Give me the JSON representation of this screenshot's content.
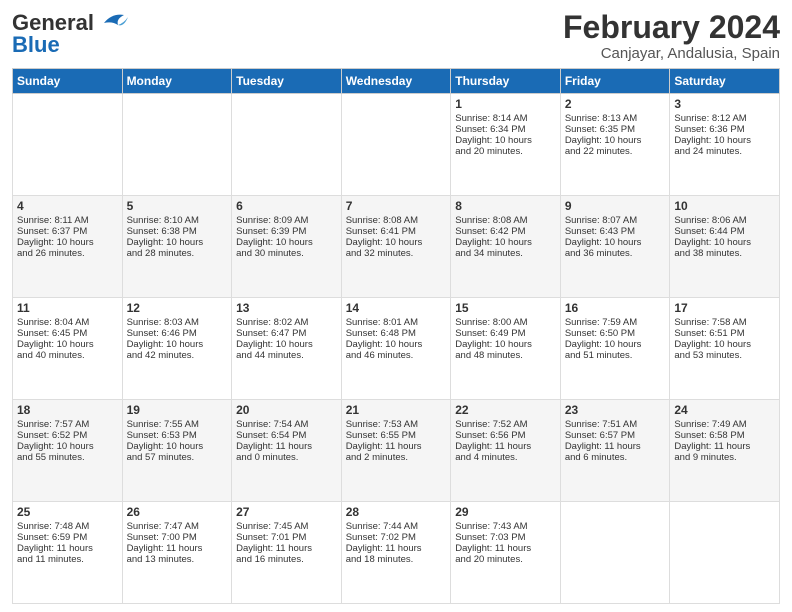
{
  "header": {
    "logo_general": "General",
    "logo_blue": "Blue",
    "month_year": "February 2024",
    "location": "Canjayar, Andalusia, Spain"
  },
  "days_of_week": [
    "Sunday",
    "Monday",
    "Tuesday",
    "Wednesday",
    "Thursday",
    "Friday",
    "Saturday"
  ],
  "weeks": [
    [
      {
        "day": "",
        "info": ""
      },
      {
        "day": "",
        "info": ""
      },
      {
        "day": "",
        "info": ""
      },
      {
        "day": "",
        "info": ""
      },
      {
        "day": "1",
        "info": "Sunrise: 8:14 AM\nSunset: 6:34 PM\nDaylight: 10 hours\nand 20 minutes."
      },
      {
        "day": "2",
        "info": "Sunrise: 8:13 AM\nSunset: 6:35 PM\nDaylight: 10 hours\nand 22 minutes."
      },
      {
        "day": "3",
        "info": "Sunrise: 8:12 AM\nSunset: 6:36 PM\nDaylight: 10 hours\nand 24 minutes."
      }
    ],
    [
      {
        "day": "4",
        "info": "Sunrise: 8:11 AM\nSunset: 6:37 PM\nDaylight: 10 hours\nand 26 minutes."
      },
      {
        "day": "5",
        "info": "Sunrise: 8:10 AM\nSunset: 6:38 PM\nDaylight: 10 hours\nand 28 minutes."
      },
      {
        "day": "6",
        "info": "Sunrise: 8:09 AM\nSunset: 6:39 PM\nDaylight: 10 hours\nand 30 minutes."
      },
      {
        "day": "7",
        "info": "Sunrise: 8:08 AM\nSunset: 6:41 PM\nDaylight: 10 hours\nand 32 minutes."
      },
      {
        "day": "8",
        "info": "Sunrise: 8:08 AM\nSunset: 6:42 PM\nDaylight: 10 hours\nand 34 minutes."
      },
      {
        "day": "9",
        "info": "Sunrise: 8:07 AM\nSunset: 6:43 PM\nDaylight: 10 hours\nand 36 minutes."
      },
      {
        "day": "10",
        "info": "Sunrise: 8:06 AM\nSunset: 6:44 PM\nDaylight: 10 hours\nand 38 minutes."
      }
    ],
    [
      {
        "day": "11",
        "info": "Sunrise: 8:04 AM\nSunset: 6:45 PM\nDaylight: 10 hours\nand 40 minutes."
      },
      {
        "day": "12",
        "info": "Sunrise: 8:03 AM\nSunset: 6:46 PM\nDaylight: 10 hours\nand 42 minutes."
      },
      {
        "day": "13",
        "info": "Sunrise: 8:02 AM\nSunset: 6:47 PM\nDaylight: 10 hours\nand 44 minutes."
      },
      {
        "day": "14",
        "info": "Sunrise: 8:01 AM\nSunset: 6:48 PM\nDaylight: 10 hours\nand 46 minutes."
      },
      {
        "day": "15",
        "info": "Sunrise: 8:00 AM\nSunset: 6:49 PM\nDaylight: 10 hours\nand 48 minutes."
      },
      {
        "day": "16",
        "info": "Sunrise: 7:59 AM\nSunset: 6:50 PM\nDaylight: 10 hours\nand 51 minutes."
      },
      {
        "day": "17",
        "info": "Sunrise: 7:58 AM\nSunset: 6:51 PM\nDaylight: 10 hours\nand 53 minutes."
      }
    ],
    [
      {
        "day": "18",
        "info": "Sunrise: 7:57 AM\nSunset: 6:52 PM\nDaylight: 10 hours\nand 55 minutes."
      },
      {
        "day": "19",
        "info": "Sunrise: 7:55 AM\nSunset: 6:53 PM\nDaylight: 10 hours\nand 57 minutes."
      },
      {
        "day": "20",
        "info": "Sunrise: 7:54 AM\nSunset: 6:54 PM\nDaylight: 11 hours\nand 0 minutes."
      },
      {
        "day": "21",
        "info": "Sunrise: 7:53 AM\nSunset: 6:55 PM\nDaylight: 11 hours\nand 2 minutes."
      },
      {
        "day": "22",
        "info": "Sunrise: 7:52 AM\nSunset: 6:56 PM\nDaylight: 11 hours\nand 4 minutes."
      },
      {
        "day": "23",
        "info": "Sunrise: 7:51 AM\nSunset: 6:57 PM\nDaylight: 11 hours\nand 6 minutes."
      },
      {
        "day": "24",
        "info": "Sunrise: 7:49 AM\nSunset: 6:58 PM\nDaylight: 11 hours\nand 9 minutes."
      }
    ],
    [
      {
        "day": "25",
        "info": "Sunrise: 7:48 AM\nSunset: 6:59 PM\nDaylight: 11 hours\nand 11 minutes."
      },
      {
        "day": "26",
        "info": "Sunrise: 7:47 AM\nSunset: 7:00 PM\nDaylight: 11 hours\nand 13 minutes."
      },
      {
        "day": "27",
        "info": "Sunrise: 7:45 AM\nSunset: 7:01 PM\nDaylight: 11 hours\nand 16 minutes."
      },
      {
        "day": "28",
        "info": "Sunrise: 7:44 AM\nSunset: 7:02 PM\nDaylight: 11 hours\nand 18 minutes."
      },
      {
        "day": "29",
        "info": "Sunrise: 7:43 AM\nSunset: 7:03 PM\nDaylight: 11 hours\nand 20 minutes."
      },
      {
        "day": "",
        "info": ""
      },
      {
        "day": "",
        "info": ""
      }
    ]
  ]
}
